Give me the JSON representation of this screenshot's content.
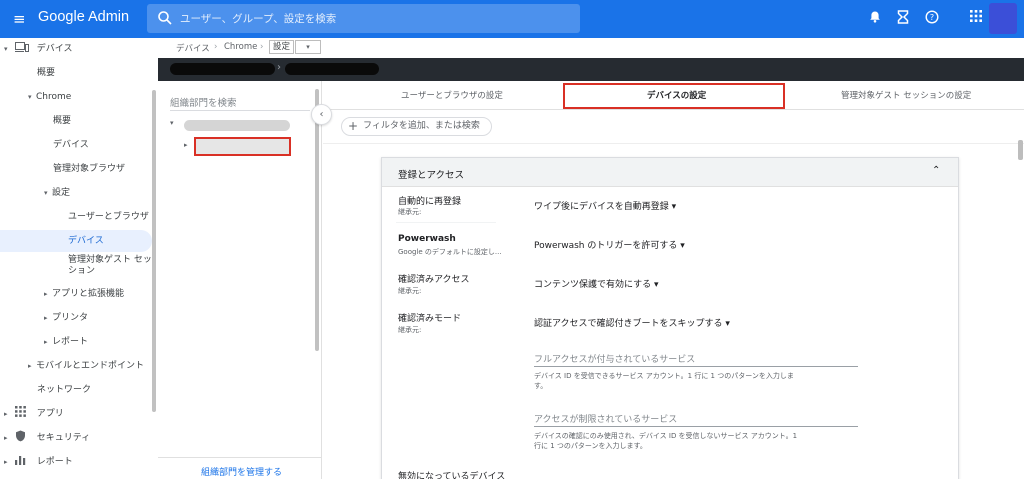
{
  "app": {
    "brand": "Google Admin",
    "search_placeholder": "ユーザー、グループ、設定を検索"
  },
  "leftnav": {
    "devices": "デバイス",
    "overview": "概要",
    "chrome": "Chrome",
    "chrome_overview": "概要",
    "chrome_devices": "デバイス",
    "managed_browsers": "管理対象ブラウザ",
    "settings": "設定",
    "users_browsers": "ユーザーとブラウザ",
    "devices_selected": "デバイス",
    "managed_guest_line1": "管理対象ゲスト セッ",
    "managed_guest_line2": "ション",
    "apps_ext": "アプリと拡張機能",
    "printers": "プリンタ",
    "reports": "レポート",
    "mobile_endpoints": "モバイルとエンドポイント",
    "network": "ネットワーク",
    "apps": "アプリ",
    "security": "セキュリティ",
    "reports_top": "レポート"
  },
  "breadcrumb": {
    "item1": "デバイス",
    "item2": "Chrome",
    "current": "設定"
  },
  "orgpanel": {
    "search_label": "組織部門を検索",
    "manage_link": "組織部門を管理する"
  },
  "tabs": {
    "users_browsers": "ユーザーとブラウザの設定",
    "device_settings": "デバイスの設定",
    "managed_guest": "管理対象ゲスト セッションの設定"
  },
  "filter": {
    "placeholder": "フィルタを追加、または検索"
  },
  "card": {
    "title": "登録とアクセス",
    "rows": [
      {
        "label": "自動的に再登録",
        "sub": "継承元:",
        "value": "ワイプ後にデバイスを自動再登録 ▾"
      },
      {
        "label": "Powerwash",
        "sub": "Google のデフォルトに設定し...",
        "value": "Powerwash のトリガーを許可する ▾"
      },
      {
        "label": "確認済みアクセス",
        "sub": "継承元:",
        "value": "コンテンツ保護で有効にする ▾"
      },
      {
        "label": "確認済みモード",
        "sub": "継承元:",
        "value": "認証アクセスで確認付きブートをスキップする ▾"
      }
    ],
    "full_access_label": "フルアクセスが付与されているサービス",
    "full_access_help_1": "デバイス ID を受信できるサービス アカウント。1 行に 1 つのパターンを入力しま",
    "full_access_help_2": "す。",
    "restricted_label": "アクセスが制限されているサービス",
    "restricted_help_1": "デバイスの確認にのみ使用され、デバイス ID を受信しないサービス アカウント。1",
    "restricted_help_2": "行に 1 つのパターンを入力します。",
    "disabled_devices": "無効になっているデバイス"
  }
}
